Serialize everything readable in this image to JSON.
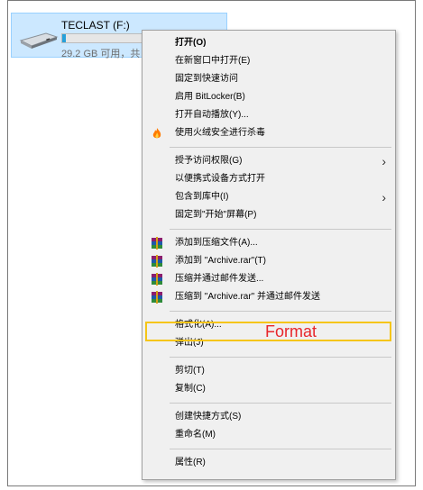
{
  "drive": {
    "name": "TECLAST (F:)",
    "free_text": "29.2 GB 可用，共",
    "used_fraction": 0.03
  },
  "menu": {
    "items": [
      {
        "label": "打开(O)",
        "bold": true
      },
      {
        "label": "在新窗口中打开(E)"
      },
      {
        "label": "固定到快速访问"
      },
      {
        "label": "启用 BitLocker(B)"
      },
      {
        "label": "打开自动播放(Y)..."
      },
      {
        "label": "使用火绒安全进行杀毒",
        "icon": "huorong-icon"
      },
      {
        "label": "授予访问权限(G)",
        "submenu": true
      },
      {
        "label": "以便携式设备方式打开"
      },
      {
        "label": "包含到库中(I)",
        "submenu": true
      },
      {
        "label": "固定到\"开始\"屏幕(P)"
      },
      {
        "label": "添加到压缩文件(A)...",
        "icon": "winrar-icon"
      },
      {
        "label": "添加到 \"Archive.rar\"(T)",
        "icon": "winrar-icon"
      },
      {
        "label": "压缩并通过邮件发送...",
        "icon": "winrar-icon"
      },
      {
        "label": "压缩到 \"Archive.rar\" 并通过邮件发送",
        "icon": "winrar-icon"
      },
      {
        "label": "格式化(A)..."
      },
      {
        "label": "弹出(J)"
      },
      {
        "label": "剪切(T)"
      },
      {
        "label": "复制(C)"
      },
      {
        "label": "创建快捷方式(S)"
      },
      {
        "label": "重命名(M)"
      },
      {
        "label": "属性(R)"
      }
    ]
  },
  "annotation": {
    "label": "Format",
    "color": "#e8262b",
    "box_color": "#f5c518"
  }
}
